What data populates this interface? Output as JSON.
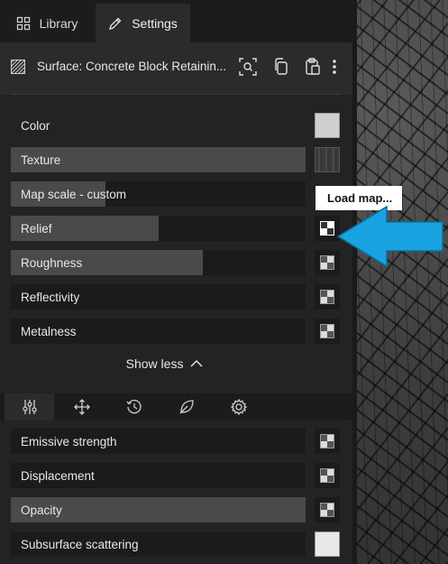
{
  "tabs": [
    {
      "label": "Library",
      "icon": "grid-icon"
    },
    {
      "label": "Settings",
      "icon": "pencil-icon",
      "active": true
    }
  ],
  "surface": {
    "title": "Surface: Concrete Block Retainin...",
    "icons": [
      "surface-pattern-icon",
      "scan-search-icon",
      "copy-icon",
      "paste-icon",
      "more-vertical-icon"
    ]
  },
  "properties": [
    {
      "label": "Color",
      "control": "color",
      "swatch": "#cfcfcf"
    },
    {
      "label": "Texture",
      "control": "texture",
      "level": 1.0
    },
    {
      "label": "Map scale - custom",
      "level": 0.32
    },
    {
      "label": "Relief",
      "level": 0.5,
      "control": "map"
    },
    {
      "label": "Roughness",
      "level": 0.65,
      "control": "map"
    },
    {
      "label": "Reflectivity",
      "level": 0.0,
      "control": "map"
    },
    {
      "label": "Metalness",
      "level": 0.0,
      "control": "map"
    }
  ],
  "tooltip": {
    "text": "Load map..."
  },
  "show_less": {
    "label": "Show less"
  },
  "tool_tabs": [
    "sliders-icon",
    "move-icon",
    "history-icon",
    "leaf-icon",
    "gear-icon"
  ],
  "lower_properties": [
    {
      "label": "Emissive strength",
      "level": 0.0,
      "control": "map"
    },
    {
      "label": "Displacement",
      "level": 0.0,
      "control": "map"
    },
    {
      "label": "Opacity",
      "level": 1.0,
      "control": "map"
    },
    {
      "label": "Subsurface scattering",
      "level": 0.0,
      "control": "color",
      "swatch": "#e8e8e8"
    }
  ],
  "colors": {
    "accent_arrow": "#1aa3e0",
    "panel_bg": "#232326"
  }
}
